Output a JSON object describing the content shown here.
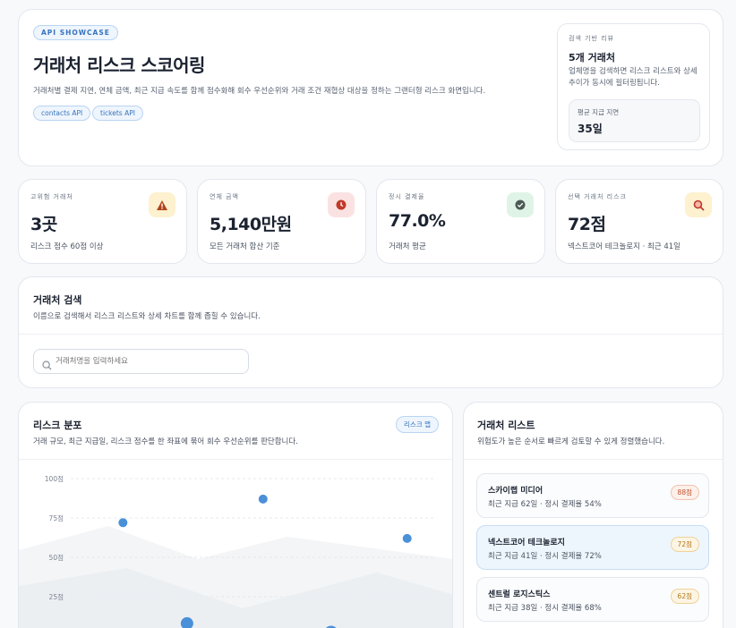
{
  "hero": {
    "badge": "API SHOWCASE",
    "title": "거래처 리스크 스코어링",
    "description": "거래처별 결제 지연, 연체 금액, 최근 지급 속도를 함께 점수화해 회수 우선순위와 거래 조건 재협상 대상을 정하는 그랜터형 리스크 화면입니다.",
    "tags": [
      "contacts API",
      "tickets API"
    ],
    "review": {
      "label": "검색 기반 리뷰",
      "count": "5개 거래처",
      "description": "업체명을 검색하면 리스크 리스트와 상세 추이가 동시에 필터링됩니다.",
      "avg_label": "평균 지급 지연",
      "avg_value": "35일"
    }
  },
  "stats": [
    {
      "label": "고위험 거래처",
      "value": "3곳",
      "note": "리스크 점수 60점 이상",
      "icon": "warning-icon",
      "bg": "#fdf1cf",
      "fg": "#b0441c"
    },
    {
      "label": "연체 금액",
      "value": "5,140만원",
      "note": "모든 거래처 합산 기준",
      "icon": "clock-icon",
      "bg": "#fbe2e2",
      "fg": "#c0392b"
    },
    {
      "label": "정시 결제율",
      "value": "77.0%",
      "note": "거래처 평균",
      "icon": "check-icon",
      "bg": "#dff4e6",
      "fg": "#3c4a44"
    },
    {
      "label": "선택 거래처 리스크",
      "value": "72점",
      "note": "넥스트코어 테크놀로지 · 최근 41일",
      "icon": "search-icon",
      "bg": "#fdf1cf",
      "fg": "#c0392b"
    }
  ],
  "search": {
    "title": "거래처 검색",
    "description": "이름으로 검색해서 리스크 리스트와 상세 차트를 함께 좁힐 수 있습니다.",
    "placeholder": "거래처명을 입력하세요"
  },
  "distribution": {
    "title": "리스크 분포",
    "description": "거래 규모, 최근 지급일, 리스크 점수를 한 좌표에 묶어 회수 우선순위를 판단합니다.",
    "badge": "리스크 맵"
  },
  "chart_data": {
    "type": "scatter",
    "y_ticks": [
      "100점",
      "75점",
      "50점",
      "25점"
    ],
    "ylim": [
      0,
      100
    ],
    "points": [
      {
        "x": 0.22,
        "y": 72,
        "size": "small"
      },
      {
        "x": 0.38,
        "y": 8,
        "size": "medium"
      },
      {
        "x": 0.57,
        "y": 87,
        "size": "small"
      },
      {
        "x": 0.74,
        "y": 2,
        "size": "large"
      },
      {
        "x": 0.93,
        "y": 62,
        "size": "small"
      }
    ],
    "point_color": "#4a90d9",
    "grid": true
  },
  "list": {
    "title": "거래처 리스트",
    "description": "위험도가 높은 순서로 빠르게 검토할 수 있게 정렬했습니다.",
    "items": [
      {
        "name": "스카이랩 미디어",
        "meta": "최근 지급 62일 · 정시 결제율 54%",
        "score": "88점",
        "color": "#c0502c",
        "bg": "#fdf0ea"
      },
      {
        "name": "넥스트코어 테크놀로지",
        "meta": "최근 지급 41일 · 정시 결제율 72%",
        "score": "72점",
        "color": "#b2771a",
        "bg": "#fdf5e4"
      },
      {
        "name": "센트럴 로지스틱스",
        "meta": "최근 지급 38일 · 정시 결제율 68%",
        "score": "62점",
        "color": "#b2771a",
        "bg": "#fdf5e4"
      }
    ]
  }
}
